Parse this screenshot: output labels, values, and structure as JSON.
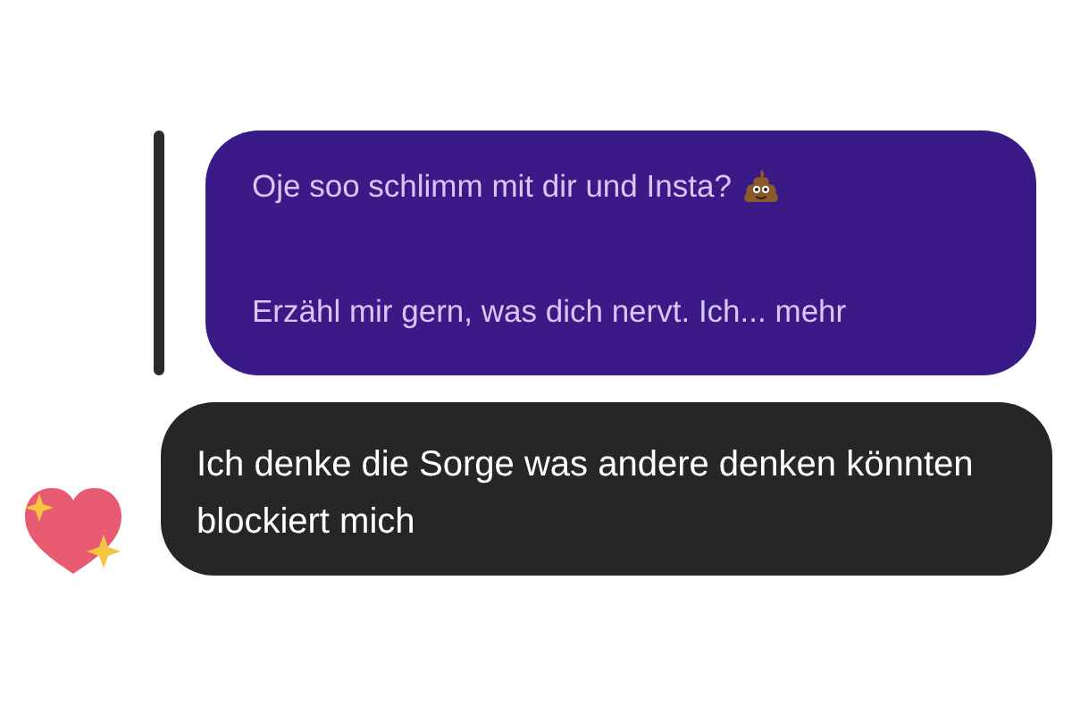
{
  "messages": [
    {
      "kind": "reply_quote",
      "lines": [
        "Oje soo schlimm mit dir und Insta?",
        "Erzähl mir gern, was dich nervt. Ich... mehr"
      ]
    },
    {
      "kind": "received",
      "text": "Ich denke die Sorge was andere denken könnten blockiert mich"
    }
  ]
}
